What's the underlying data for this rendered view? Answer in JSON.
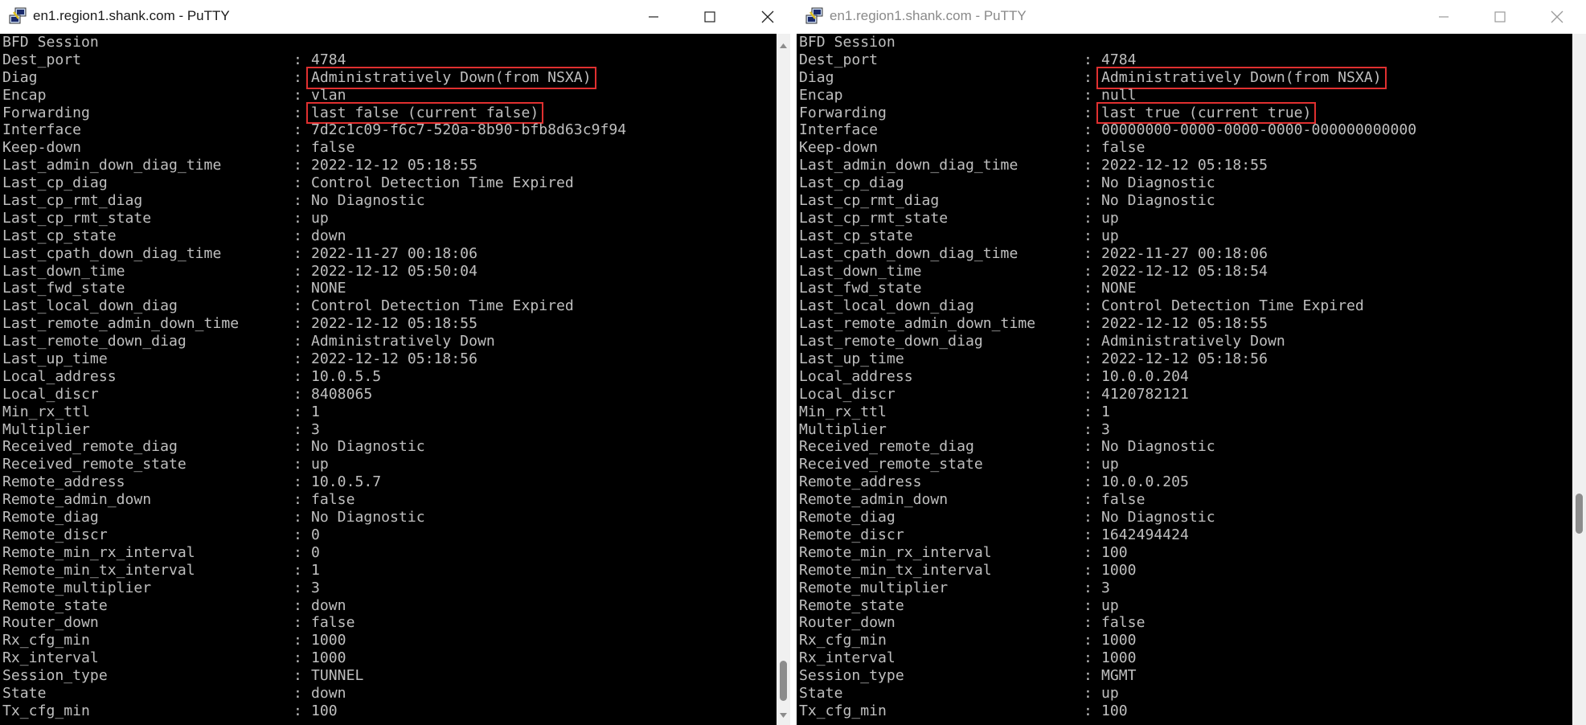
{
  "colors": {
    "terminal_bg": "#000000",
    "terminal_fg": "#bfbfbf",
    "highlight_box": "#e03030",
    "titlebar_bg": "#ffffff"
  },
  "left_window": {
    "title": "en1.region1.shank.com - PuTTY",
    "active": true,
    "controls": [
      "minimize-icon",
      "maximize-icon",
      "close-icon"
    ],
    "lines": [
      {
        "key": "BFD Session",
        "value": null
      },
      {
        "key": "Dest_port",
        "value": "4784"
      },
      {
        "key": "Diag",
        "value": "Administratively Down(from NSXA)",
        "highlighted": true
      },
      {
        "key": "Encap",
        "value": "vlan"
      },
      {
        "key": "Forwarding",
        "value": "last false (current false)",
        "highlighted": true
      },
      {
        "key": "Interface",
        "value": "7d2c1c09-f6c7-520a-8b90-bfb8d63c9f94"
      },
      {
        "key": "Keep-down",
        "value": "false"
      },
      {
        "key": "Last_admin_down_diag_time",
        "value": "2022-12-12 05:18:55"
      },
      {
        "key": "Last_cp_diag",
        "value": "Control Detection Time Expired"
      },
      {
        "key": "Last_cp_rmt_diag",
        "value": "No Diagnostic"
      },
      {
        "key": "Last_cp_rmt_state",
        "value": "up"
      },
      {
        "key": "Last_cp_state",
        "value": "down"
      },
      {
        "key": "Last_cpath_down_diag_time",
        "value": "2022-11-27 00:18:06"
      },
      {
        "key": "Last_down_time",
        "value": "2022-12-12 05:50:04"
      },
      {
        "key": "Last_fwd_state",
        "value": "NONE"
      },
      {
        "key": "Last_local_down_diag",
        "value": "Control Detection Time Expired"
      },
      {
        "key": "Last_remote_admin_down_time",
        "value": "2022-12-12 05:18:55"
      },
      {
        "key": "Last_remote_down_diag",
        "value": "Administratively Down"
      },
      {
        "key": "Last_up_time",
        "value": "2022-12-12 05:18:56"
      },
      {
        "key": "Local_address",
        "value": "10.0.5.5"
      },
      {
        "key": "Local_discr",
        "value": "8408065"
      },
      {
        "key": "Min_rx_ttl",
        "value": "1"
      },
      {
        "key": "Multiplier",
        "value": "3"
      },
      {
        "key": "Received_remote_diag",
        "value": "No Diagnostic"
      },
      {
        "key": "Received_remote_state",
        "value": "up"
      },
      {
        "key": "Remote_address",
        "value": "10.0.5.7"
      },
      {
        "key": "Remote_admin_down",
        "value": "false"
      },
      {
        "key": "Remote_diag",
        "value": "No Diagnostic"
      },
      {
        "key": "Remote_discr",
        "value": "0"
      },
      {
        "key": "Remote_min_rx_interval",
        "value": "0"
      },
      {
        "key": "Remote_min_tx_interval",
        "value": "1"
      },
      {
        "key": "Remote_multiplier",
        "value": "3"
      },
      {
        "key": "Remote_state",
        "value": "down"
      },
      {
        "key": "Router_down",
        "value": "false"
      },
      {
        "key": "Rx_cfg_min",
        "value": "1000"
      },
      {
        "key": "Rx_interval",
        "value": "1000"
      },
      {
        "key": "Session_type",
        "value": "TUNNEL"
      },
      {
        "key": "State",
        "value": "down"
      },
      {
        "key": "Tx_cfg_min",
        "value": "100"
      }
    ]
  },
  "right_window": {
    "title": "en1.region1.shank.com - PuTTY",
    "active": false,
    "controls": [
      "minimize-icon",
      "maximize-icon",
      "close-icon"
    ],
    "lines": [
      {
        "key": "BFD Session",
        "value": null
      },
      {
        "key": "Dest_port",
        "value": "4784"
      },
      {
        "key": "Diag",
        "value": "Administratively Down(from NSXA)",
        "highlighted": true
      },
      {
        "key": "Encap",
        "value": "null"
      },
      {
        "key": "Forwarding",
        "value": "last true (current true)",
        "highlighted": true
      },
      {
        "key": "Interface",
        "value": "00000000-0000-0000-0000-000000000000"
      },
      {
        "key": "Keep-down",
        "value": "false"
      },
      {
        "key": "Last_admin_down_diag_time",
        "value": "2022-12-12 05:18:55"
      },
      {
        "key": "Last_cp_diag",
        "value": "No Diagnostic"
      },
      {
        "key": "Last_cp_rmt_diag",
        "value": "No Diagnostic"
      },
      {
        "key": "Last_cp_rmt_state",
        "value": "up"
      },
      {
        "key": "Last_cp_state",
        "value": "up"
      },
      {
        "key": "Last_cpath_down_diag_time",
        "value": "2022-11-27 00:18:06"
      },
      {
        "key": "Last_down_time",
        "value": "2022-12-12 05:18:54"
      },
      {
        "key": "Last_fwd_state",
        "value": "NONE"
      },
      {
        "key": "Last_local_down_diag",
        "value": "Control Detection Time Expired"
      },
      {
        "key": "Last_remote_admin_down_time",
        "value": "2022-12-12 05:18:55"
      },
      {
        "key": "Last_remote_down_diag",
        "value": "Administratively Down"
      },
      {
        "key": "Last_up_time",
        "value": "2022-12-12 05:18:56"
      },
      {
        "key": "Local_address",
        "value": "10.0.0.204"
      },
      {
        "key": "Local_discr",
        "value": "4120782121"
      },
      {
        "key": "Min_rx_ttl",
        "value": "1"
      },
      {
        "key": "Multiplier",
        "value": "3"
      },
      {
        "key": "Received_remote_diag",
        "value": "No Diagnostic"
      },
      {
        "key": "Received_remote_state",
        "value": "up"
      },
      {
        "key": "Remote_address",
        "value": "10.0.0.205"
      },
      {
        "key": "Remote_admin_down",
        "value": "false"
      },
      {
        "key": "Remote_diag",
        "value": "No Diagnostic"
      },
      {
        "key": "Remote_discr",
        "value": "1642494424"
      },
      {
        "key": "Remote_min_rx_interval",
        "value": "100"
      },
      {
        "key": "Remote_min_tx_interval",
        "value": "1000"
      },
      {
        "key": "Remote_multiplier",
        "value": "3"
      },
      {
        "key": "Remote_state",
        "value": "up"
      },
      {
        "key": "Router_down",
        "value": "false"
      },
      {
        "key": "Rx_cfg_min",
        "value": "1000"
      },
      {
        "key": "Rx_interval",
        "value": "1000"
      },
      {
        "key": "Session_type",
        "value": "MGMT"
      },
      {
        "key": "State",
        "value": "up"
      },
      {
        "key": "Tx_cfg_min",
        "value": "100"
      }
    ]
  }
}
